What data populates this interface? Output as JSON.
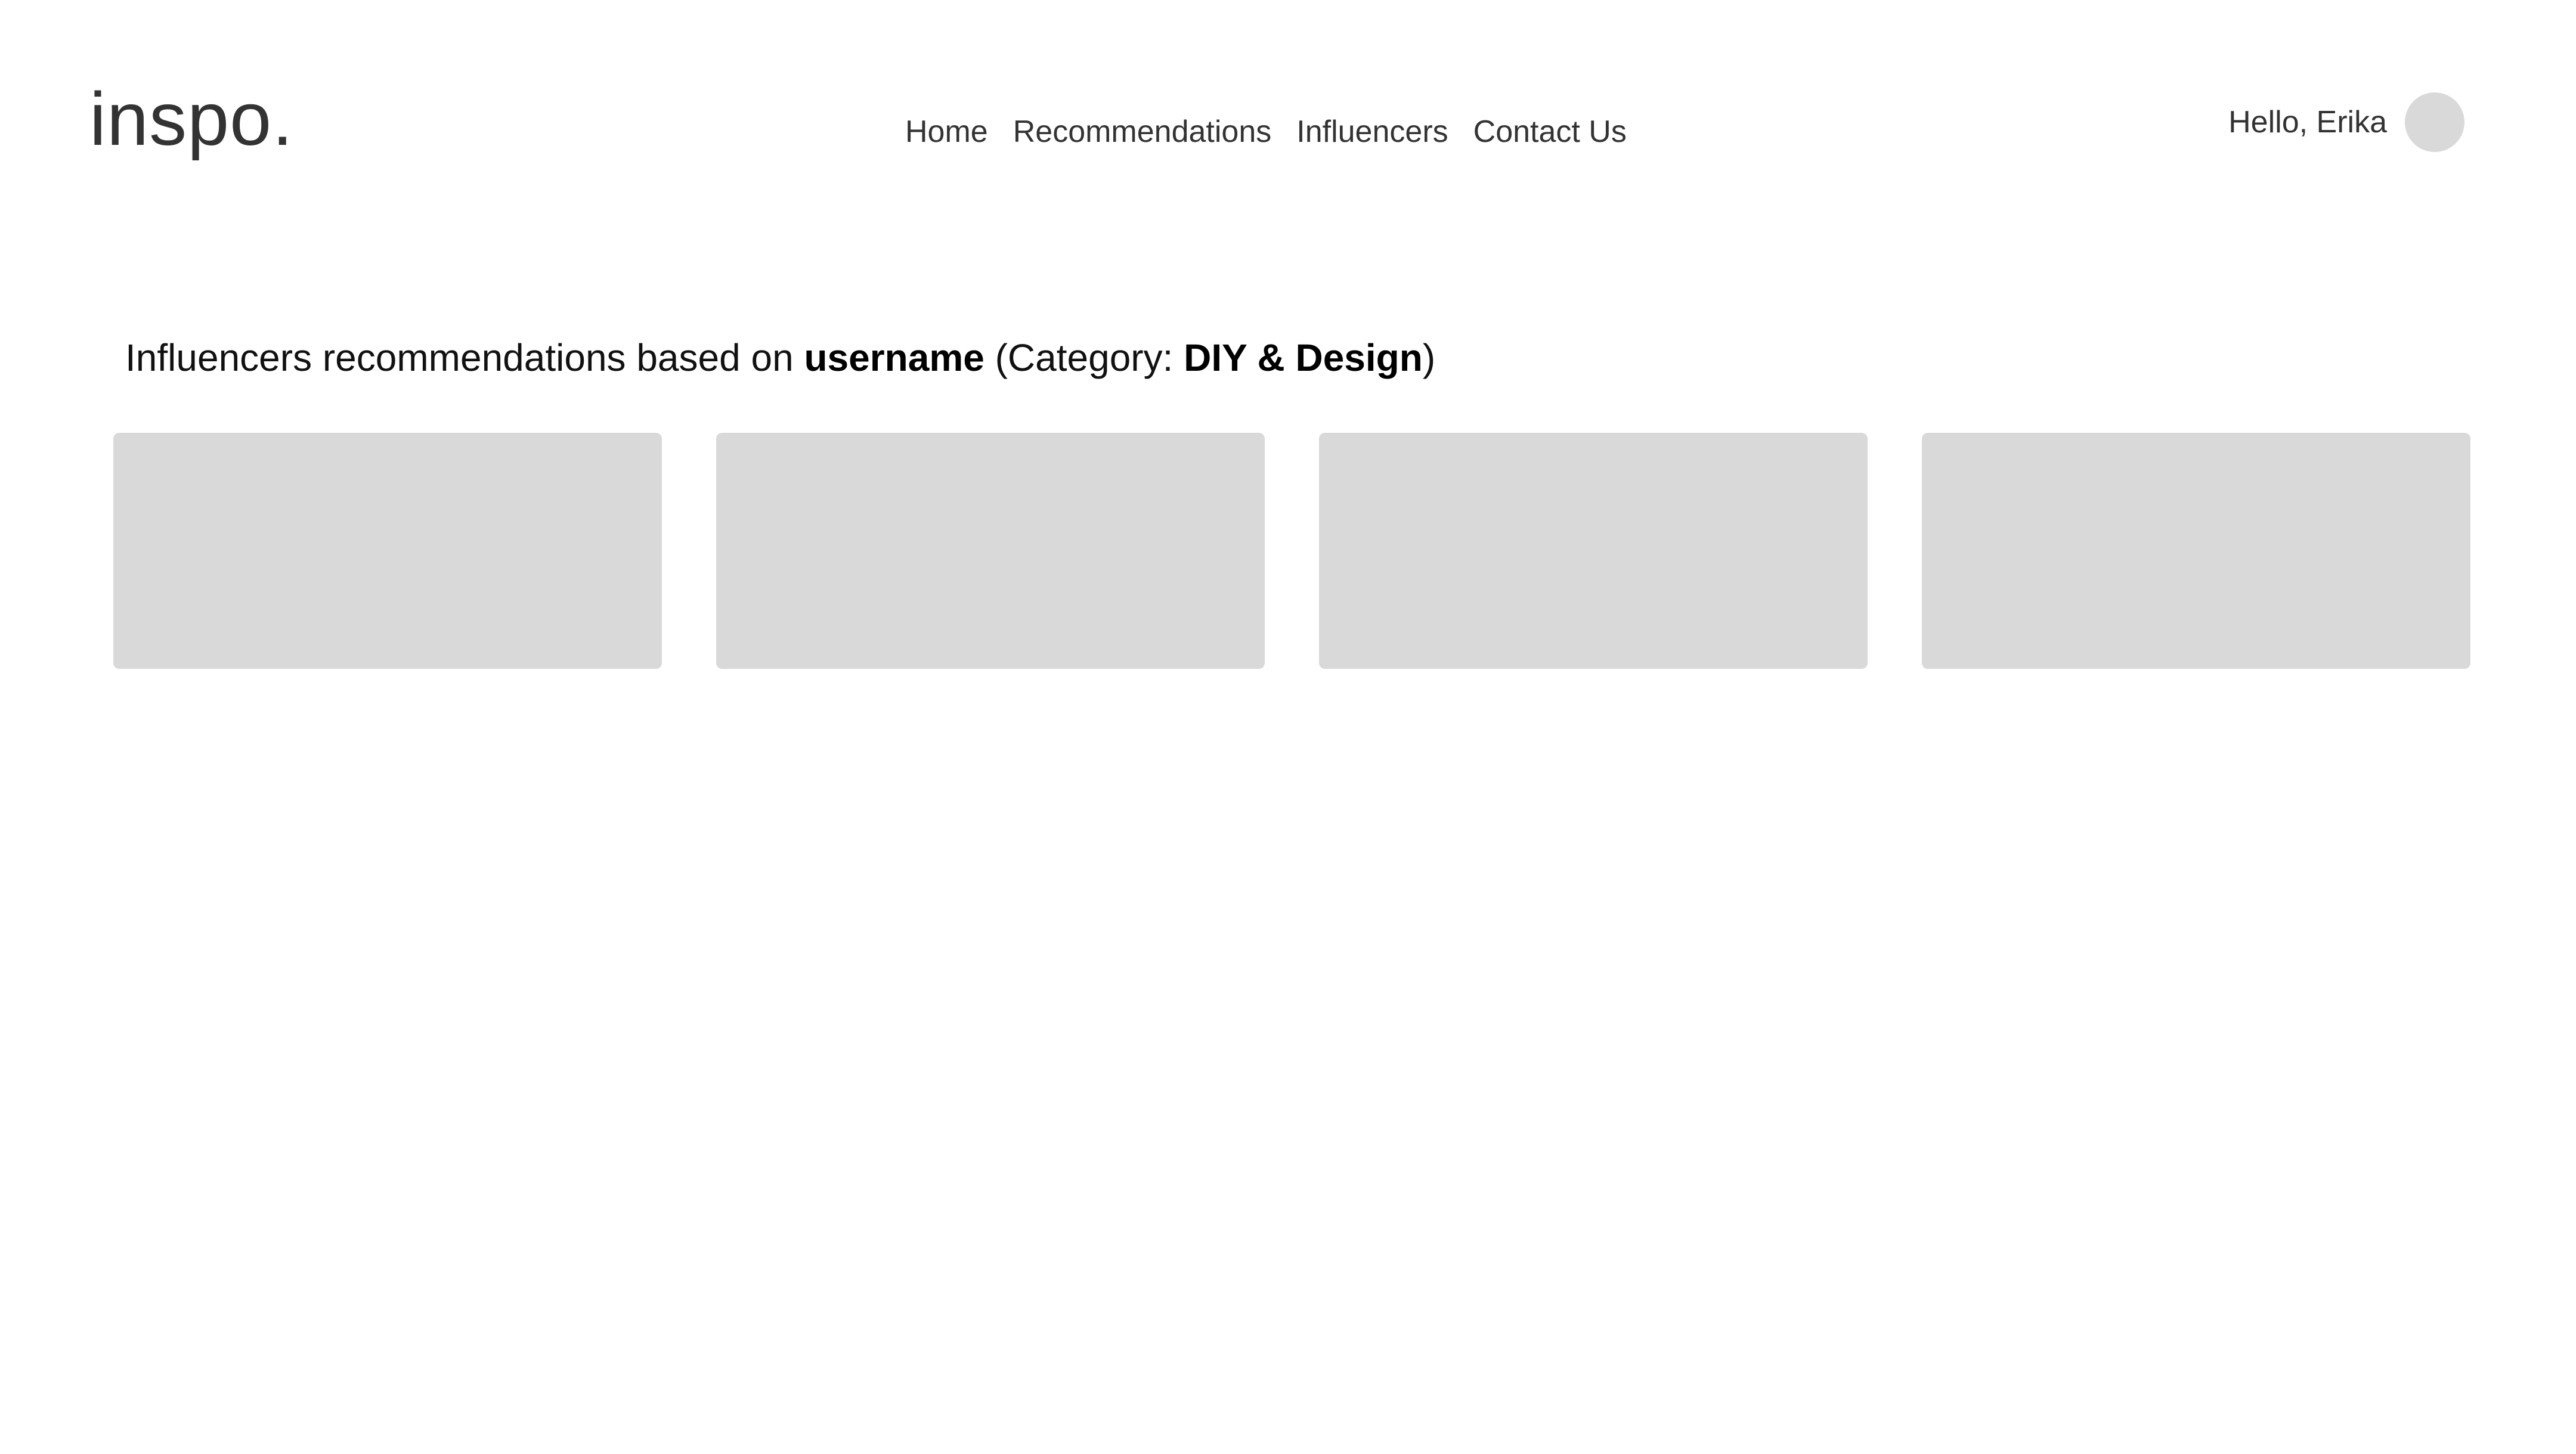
{
  "header": {
    "logo": "inspo.",
    "nav": [
      {
        "label": "Home"
      },
      {
        "label": "Recommendations"
      },
      {
        "label": "Influencers"
      },
      {
        "label": "Contact Us"
      }
    ],
    "greeting": "Hello, Erika"
  },
  "main": {
    "heading": {
      "prefix": "Influencers recommendations based on ",
      "username": "username",
      "category_open": " (Category: ",
      "category": "DIY & Design",
      "category_close": ")"
    },
    "cards_count": 4
  },
  "colors": {
    "placeholder": "#d9d9d9",
    "text": "#333333"
  }
}
